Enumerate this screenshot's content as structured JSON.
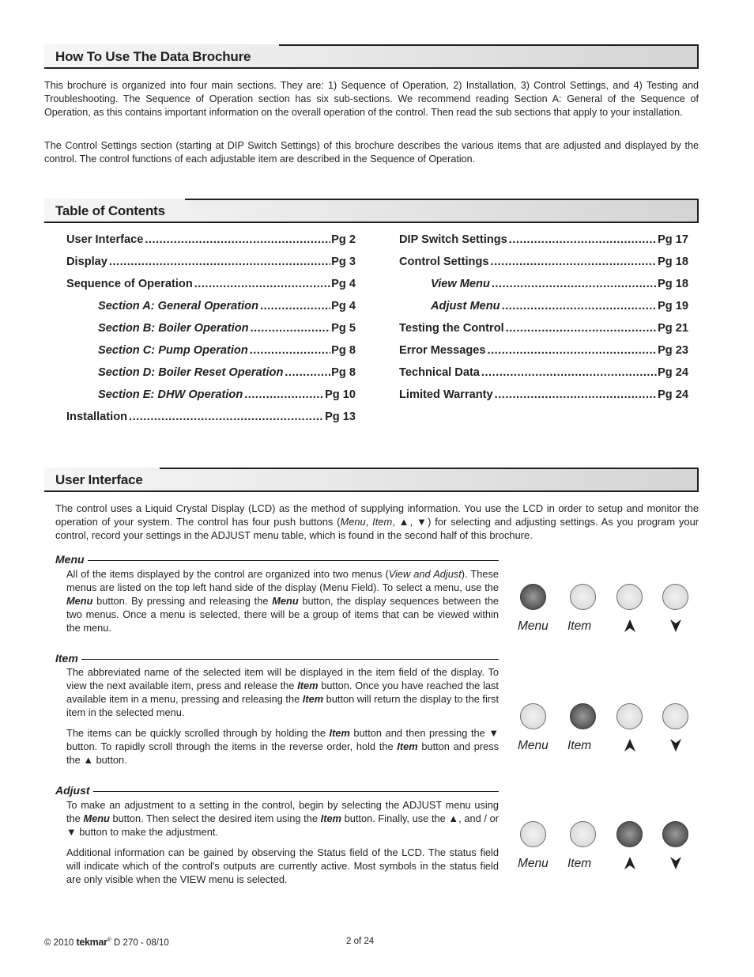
{
  "sections": {
    "how_to_use": {
      "title": "How To Use The Data Brochure",
      "paragraphs": [
        "This brochure is organized into four main sections. They are: 1) Sequence of Operation, 2) Installation, 3) Control Settings, and 4) Testing and Troubleshooting. The Sequence of Operation section has six sub-sections. We recommend reading Section A: General of the Sequence of Operation, as this contains important information on the overall operation of the control. Then read the sub sections that apply to your installation.",
        "The Control Settings section (starting at DIP Switch Settings) of this brochure describes the various items that are adjusted and displayed by the control. The control functions of each adjustable item are described in the Sequence of Operation."
      ]
    },
    "toc": {
      "title": "Table of Contents",
      "left": [
        {
          "label": "User Interface",
          "page": "Pg 2",
          "sub": false
        },
        {
          "label": "Display",
          "page": "Pg 3",
          "sub": false
        },
        {
          "label": "Sequence of Operation",
          "page": "Pg 4",
          "sub": false
        },
        {
          "label": "Section A: General Operation",
          "page": "Pg 4",
          "sub": true
        },
        {
          "label": "Section B: Boiler Operation",
          "page": "Pg 5",
          "sub": true
        },
        {
          "label": "Section C: Pump Operation",
          "page": "Pg 8",
          "sub": true
        },
        {
          "label": "Section D: Boiler Reset Operation",
          "page": "Pg 8",
          "sub": true
        },
        {
          "label": "Section E: DHW Operation",
          "page": "Pg 10",
          "sub": true
        },
        {
          "label": "Installation",
          "page": "Pg 13",
          "sub": false
        }
      ],
      "right": [
        {
          "label": "DIP Switch Settings",
          "page": "Pg 17",
          "sub": false
        },
        {
          "label": "Control Settings",
          "page": "Pg 18",
          "sub": false
        },
        {
          "label": "View Menu",
          "page": "Pg 18",
          "sub": true
        },
        {
          "label": "Adjust Menu",
          "page": "Pg 19",
          "sub": true
        },
        {
          "label": "Testing the Control",
          "page": "Pg 21",
          "sub": false
        },
        {
          "label": "Error Messages",
          "page": "Pg 23",
          "sub": false
        },
        {
          "label": "Technical Data",
          "page": "Pg 24",
          "sub": false
        },
        {
          "label": "Limited Warranty",
          "page": "Pg 24",
          "sub": false
        }
      ]
    },
    "user_interface": {
      "title": "User Interface",
      "intro": {
        "t1": "The control uses a Liquid Crystal Display (LCD) as the method of supplying information. You use the LCD in order to setup and monitor the operation of your system. The control has four push buttons (",
        "menu": "Menu",
        "sep1": ", ",
        "item": "Item",
        "sep2": ", ",
        "up": "▲",
        "sep3": ", ",
        "down": "▼",
        "t2": ") for selecting and adjusting settings. As you program your control, record your settings in the ADJUST menu table, which is found in the second half of this brochure."
      },
      "menu": {
        "heading": "Menu",
        "p1": {
          "a": "All of the items displayed by the control are organized into two menus (",
          "em": "View and Adjust",
          "b": "). These menus are listed on the top left hand side of the display (Menu Field). To select a menu, use the ",
          "strong1": "Menu",
          "c": " button. By pressing and releasing the ",
          "strong2": "Menu",
          "d": " button, the display sequences between the two menus. Once a menu is selected, there will be a group of items that can be viewed within the menu."
        }
      },
      "item": {
        "heading": "Item",
        "p1": {
          "a": "The abbreviated name of the selected item will be displayed in the item field of the display. To view the next available item, press and release the ",
          "strong1": "Item",
          "b": " button. Once you have reached the last available item in a menu, pressing and releasing the ",
          "strong2": "Item",
          "c": " button will return the display to the first item in the selected menu."
        },
        "p2": {
          "a": "The items can be quickly scrolled through by holding the ",
          "strong1": "Item",
          "b": " button and then pressing the ▼ button. To rapidly scroll through the items in the reverse order, hold the ",
          "strong2": "Item",
          "c": " button and press the ▲ button."
        }
      },
      "adjust": {
        "heading": "Adjust",
        "p1": {
          "a": "To make an adjustment to a setting in the control, begin by selecting the ADJUST menu using the ",
          "strong1": "Menu",
          "b": " button. Then select the desired item using the ",
          "strong2": "Item",
          "c": " button. Finally, use the ▲, and / or ▼ button to make the adjustment."
        },
        "p2": "Additional information can be gained by observing the Status field of the LCD. The status field will indicate which of the control's outputs are currently active. Most symbols in the status field are only visible when the VIEW menu is selected."
      },
      "button_diagrams": [
        {
          "highlighted": [
            "menu"
          ]
        },
        {
          "highlighted": [
            "item"
          ]
        },
        {
          "highlighted": [
            "up",
            "down"
          ]
        }
      ],
      "button_labels": {
        "menu": "Menu",
        "item": "Item",
        "up_icon": "up-arrow-icon",
        "down_icon": "down-arrow-icon"
      }
    }
  },
  "footer": {
    "copyright": "© 2010",
    "brand": "tekmar",
    "brand_mark": "®",
    "doc_code": "D 270 - 08/10",
    "page": "2 of 24"
  },
  "colors": {
    "text": "#231f20",
    "button_off": "#dcdcdc",
    "button_on": "#5a5a5a"
  }
}
